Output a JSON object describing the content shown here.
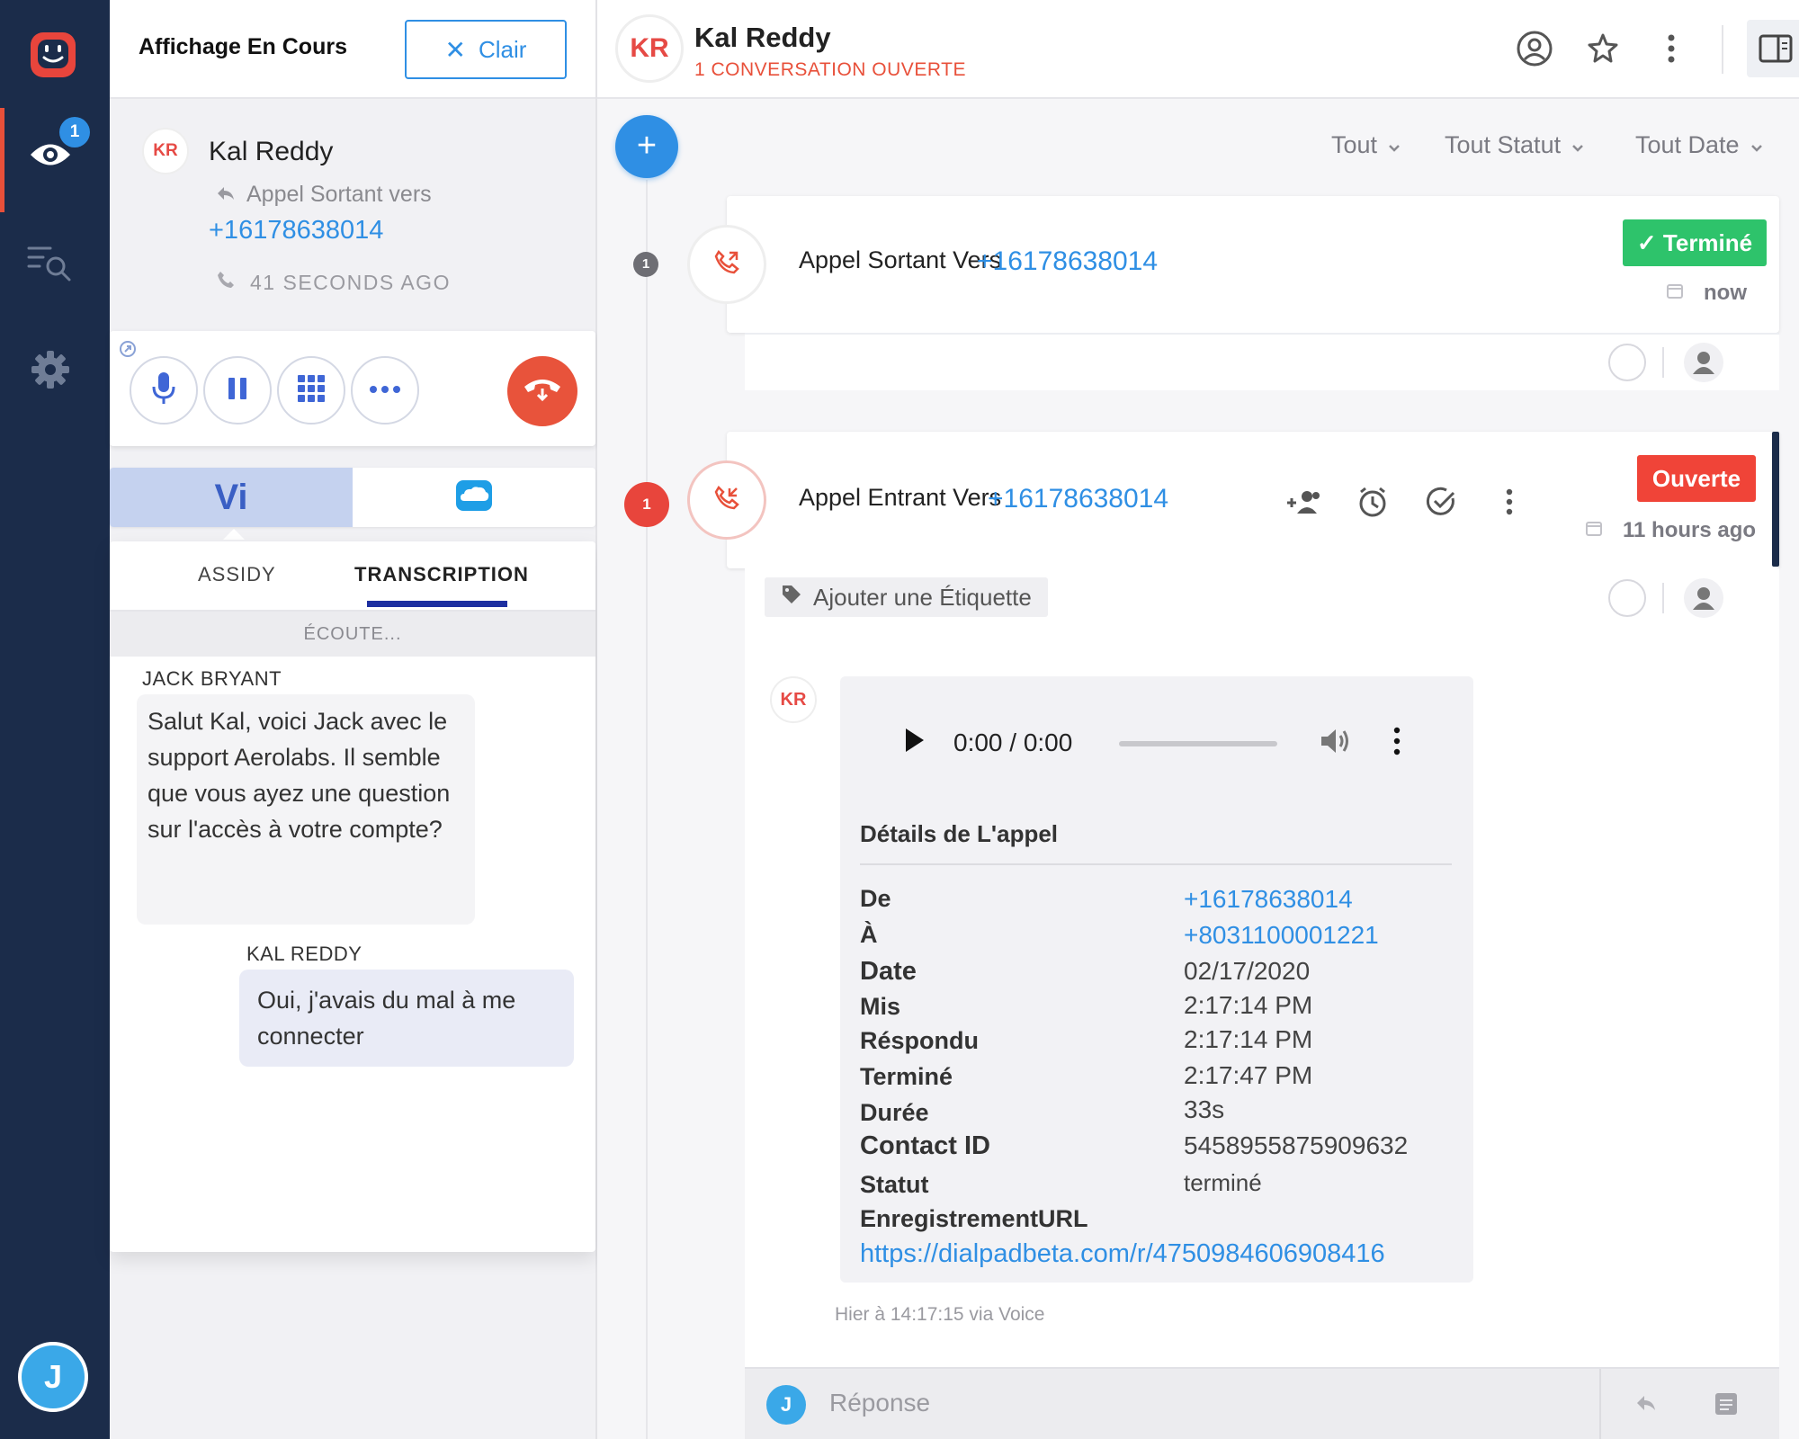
{
  "colors": {
    "nav_bg": "#1b2c4a",
    "accent_blue": "#2f8fe4",
    "accent_red": "#e8503a",
    "done_green": "#2ec36b",
    "open_red": "#f04438"
  },
  "nav": {
    "badge_count": "1",
    "user_initial": "J",
    "icons": [
      "app-logo-icon",
      "eye-icon",
      "search-list-icon",
      "gear-icon"
    ]
  },
  "panel": {
    "title": "Affichage En Cours",
    "clear_label": "Clair",
    "call": {
      "initials": "KR",
      "name": "Kal Reddy",
      "direction": "Appel Sortant vers",
      "number": "+16178638014",
      "ago": "41 SECONDS AGO"
    },
    "app_tabs": {
      "vi_label": "Vi"
    },
    "subtabs": {
      "assidy": "ASSIDY",
      "transcription": "TRANSCRIPTION"
    },
    "listening": "ÉCOUTE...",
    "messages": [
      {
        "speaker": "JACK BRYANT",
        "text": "Salut Kal, voici Jack avec le support Aerolabs. Il semble que vous ayez une question sur l'accès à votre compte?"
      },
      {
        "speaker": "KAL REDDY",
        "text": "Oui, j'avais du mal à me connecter"
      }
    ]
  },
  "header": {
    "initials": "KR",
    "name": "Kal Reddy",
    "subtitle": "1 CONVERSATION OUVERTE"
  },
  "filters": {
    "all": "Tout",
    "status": "Tout Statut",
    "date": "Tout Date"
  },
  "threads": [
    {
      "count": "1",
      "title": "Appel Sortant Vers",
      "number": "+16178638014",
      "status": "Terminé",
      "time": "now"
    },
    {
      "count": "1",
      "title": "Appel Entrant Vers",
      "number": "+16178638014",
      "status": "Ouverte",
      "time": "11 hours ago",
      "tag_label": "Ajouter une Étiquette"
    }
  ],
  "message": {
    "initials": "KR",
    "audio_time": "0:00 / 0:00",
    "details_title": "Détails de L'appel",
    "details": [
      {
        "label": "De",
        "value": "+16178638014"
      },
      {
        "label": "À",
        "value": "+8031100001221"
      },
      {
        "label": "Date",
        "value": "02/17/2020"
      },
      {
        "label": "Mis",
        "value": "2:17:14 PM"
      },
      {
        "label": "Réspondu",
        "value": "2:17:14 PM"
      },
      {
        "label": "Terminé",
        "value": "2:17:47 PM"
      },
      {
        "label": "Durée",
        "value": "33s"
      },
      {
        "label": "Contact ID",
        "value": "5458955875909632"
      },
      {
        "label": "Statut",
        "value": "terminé"
      },
      {
        "label": "EnregistrementURL",
        "value": ""
      }
    ],
    "recording_url": "https://dialpadbeta.com/r/4750984606908416",
    "meta": "Hier à 14:17:15 via Voice"
  },
  "reply": {
    "initial": "J",
    "placeholder": "Réponse"
  }
}
